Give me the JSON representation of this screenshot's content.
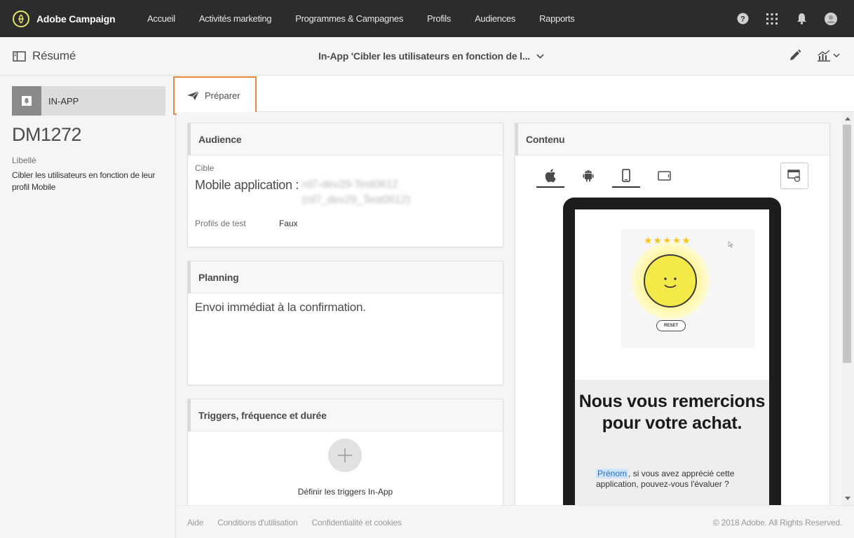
{
  "app": {
    "name": "Adobe Campaign",
    "nav": [
      "Accueil",
      "Activités marketing",
      "Programmes & Campagnes",
      "Profils",
      "Audiences",
      "Rapports"
    ],
    "icons": [
      "help-icon",
      "apps-grid-icon",
      "bell-icon",
      "user-avatar-icon"
    ]
  },
  "titlebar": {
    "summary_label": "Résumé",
    "title": "In-App 'Cibler les utilisateurs en fonction de l..."
  },
  "left": {
    "channel": "IN-APP",
    "delivery_id": "DM1272",
    "libelle_label": "Libellé",
    "libelle_value": "Cibler les utilisateurs en fonction de leur profil Mobile"
  },
  "toolbar": {
    "prepare_label": "Préparer"
  },
  "audience": {
    "title": "Audience",
    "cible_label": "Cible",
    "cible_prefix": "Mobile application :",
    "cible_value": "rd7-dev29-Test0612 (rd7_dev29_Test0612)",
    "test_profiles_label": "Profils de test",
    "test_profiles_value": "Faux"
  },
  "planning": {
    "title": "Planning",
    "text": "Envoi immédiat à la confirmation."
  },
  "triggers": {
    "title": "Triggers, fréquence et durée",
    "define_label": "Définir les triggers In-App"
  },
  "contenu": {
    "title": "Contenu",
    "device_tabs": [
      "apple-icon",
      "android-icon",
      "phone-icon",
      "tablet-icon"
    ],
    "active_tab": "phone-icon",
    "stars": "★★★★★",
    "reset_label": "RESET",
    "thanks_title": "Nous vous remercions pour votre achat.",
    "prenom": "Prénom",
    "thanks_body": ", si vous avez apprécié cette application, pouvez-vous l'évaluer ?"
  },
  "footer": {
    "links": [
      "Aide",
      "Conditions d'utilisation",
      "Confidentialité et cookies"
    ],
    "copyright": "© 2018 Adobe. All Rights Reserved."
  },
  "colors": {
    "topbar_bg": "#2c2c2c",
    "accent_highlight": "#e68a3a",
    "logo_yellow": "#e8e26a"
  }
}
